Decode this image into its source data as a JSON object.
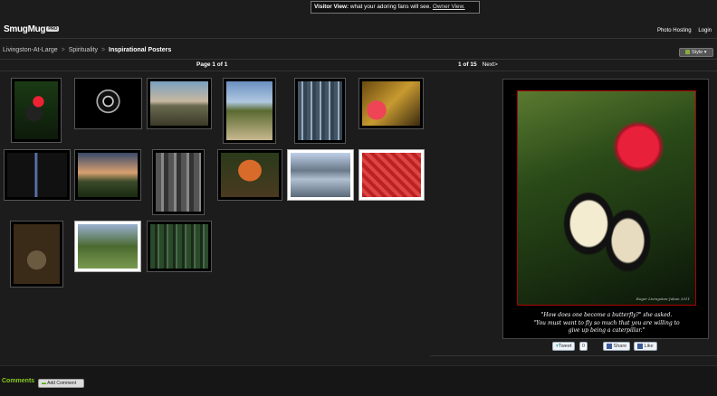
{
  "visitor_bar": {
    "label": "Visitor View:",
    "message": " what your adoring fans will see.",
    "owner_link": "Owner View."
  },
  "header": {
    "logo": "SmugMug",
    "logo_badge": "PRO",
    "links": [
      "Photo Hosting",
      "Login"
    ]
  },
  "breadcrumb": {
    "items": [
      "Livingston-At-Large",
      "Spirituality"
    ],
    "current": "Inspirational Posters",
    "separator": ">"
  },
  "style_button": "Style",
  "pager": {
    "page": "Page 1 of 1",
    "position": "1 of 15",
    "next": "Next>"
  },
  "main_caption": {
    "line1": "\"How does one become a butterfly?\" she asked.",
    "line2": "\"You must want to fly so much that you are willing to",
    "line3": "give up being a caterpillar.\"",
    "signature": "Roger Livingston-Julian 2011"
  },
  "share": {
    "tweet": "Tweet",
    "tweet_count": "0",
    "facebook_share": "Share",
    "facebook_like": "Like"
  },
  "comments": {
    "label": "Comments",
    "add_button": "Add Comment"
  },
  "colors": {
    "background": "#1c1c1c",
    "comments_green": "#88cc22"
  }
}
